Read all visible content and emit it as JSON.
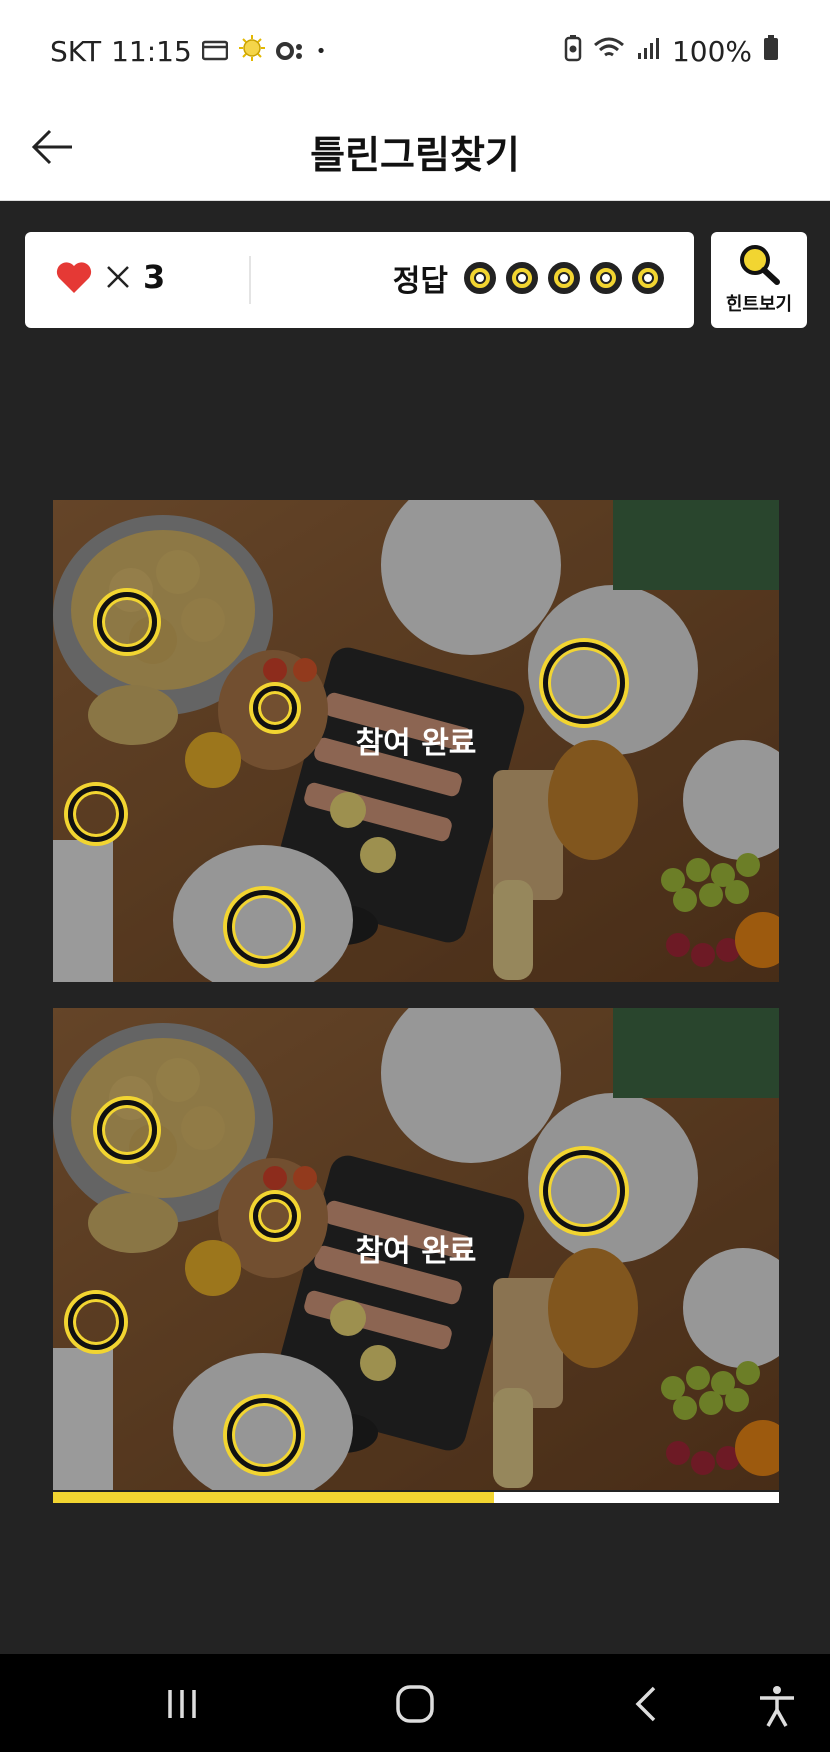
{
  "status_bar": {
    "carrier": "SKT",
    "time": "11:15",
    "battery": "100%"
  },
  "header": {
    "title": "틀린그림찾기"
  },
  "score": {
    "lives_count": "3",
    "answers_label": "정답",
    "answers_total": 5,
    "answers_found": 5
  },
  "hint": {
    "label": "힌트보기"
  },
  "images": {
    "top_overlay_text": "참여 완료",
    "bottom_overlay_text": "참여 완료"
  },
  "progress": {
    "fraction": 0.607
  },
  "colors": {
    "accent": "#f2d531",
    "heart": "#e53935",
    "background": "#232323"
  },
  "icons": [
    "back-arrow-icon",
    "heart-icon",
    "times-icon",
    "magnifier-icon",
    "recent-apps-icon",
    "home-icon",
    "nav-back-icon",
    "accessibility-icon"
  ]
}
